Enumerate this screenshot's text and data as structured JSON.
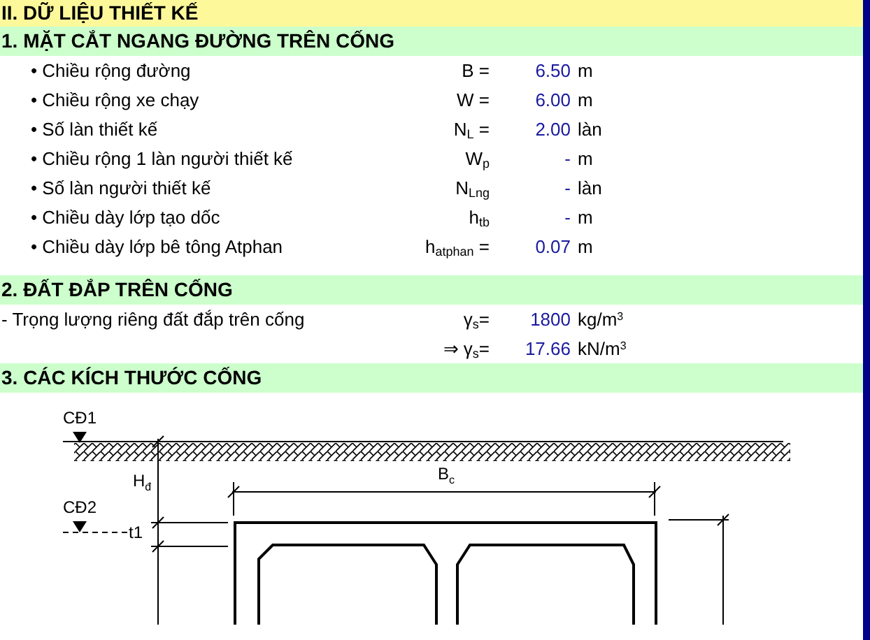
{
  "title": "II. DỮ LIỆU THIẾT KẾ",
  "sections": [
    {
      "heading": "1. MẶT CẮT NGANG ĐƯỜNG TRÊN CỐNG",
      "rows": [
        {
          "label": "• Chiều rộng đường",
          "symbol": "B =",
          "value": "6.50",
          "unit": "m"
        },
        {
          "label": "• Chiều rộng xe chạy",
          "symbol": "W =",
          "value": "6.00",
          "unit": "m"
        },
        {
          "label": "• Số làn thiết kế",
          "symbol": "N$_{L}$ =",
          "value": "2.00",
          "unit": "làn"
        },
        {
          "label": "• Chiều rộng 1 làn người thiết kế",
          "symbol": "W$_{p}$",
          "value": "-",
          "unit": "m"
        },
        {
          "label": "• Số làn người thiết kế",
          "symbol": "N$_{Lng}$",
          "value": "-",
          "unit": "làn"
        },
        {
          "label": "• Chiều dày lớp tạo dốc",
          "symbol": "h$_{tb}$",
          "value": "-",
          "unit": "m"
        },
        {
          "label": "• Chiều dày lớp bê tông Atphan",
          "symbol": "h$_{atphan}$ =",
          "value": "0.07",
          "unit": "m"
        }
      ]
    },
    {
      "heading": "2. ĐẤT ĐẮP TRÊN CỐNG",
      "rows": [
        {
          "label": "- Trọng lượng riêng đất đắp trên cống",
          "symbol": "γ$_{s}$=",
          "value": "1800",
          "unit": "kg/m$^{3}$"
        },
        {
          "symbol": "⇒ γ$_{s}$=",
          "value": "17.66",
          "unit": "kN/m$^{3}$"
        }
      ]
    },
    {
      "heading": "3. CÁC KÍCH THƯỚC CỐNG"
    }
  ],
  "drawing": {
    "labels": [
      "CĐ1",
      "CĐ2",
      "H$_{đ}$",
      "B$_{c}$",
      "t1"
    ]
  }
}
